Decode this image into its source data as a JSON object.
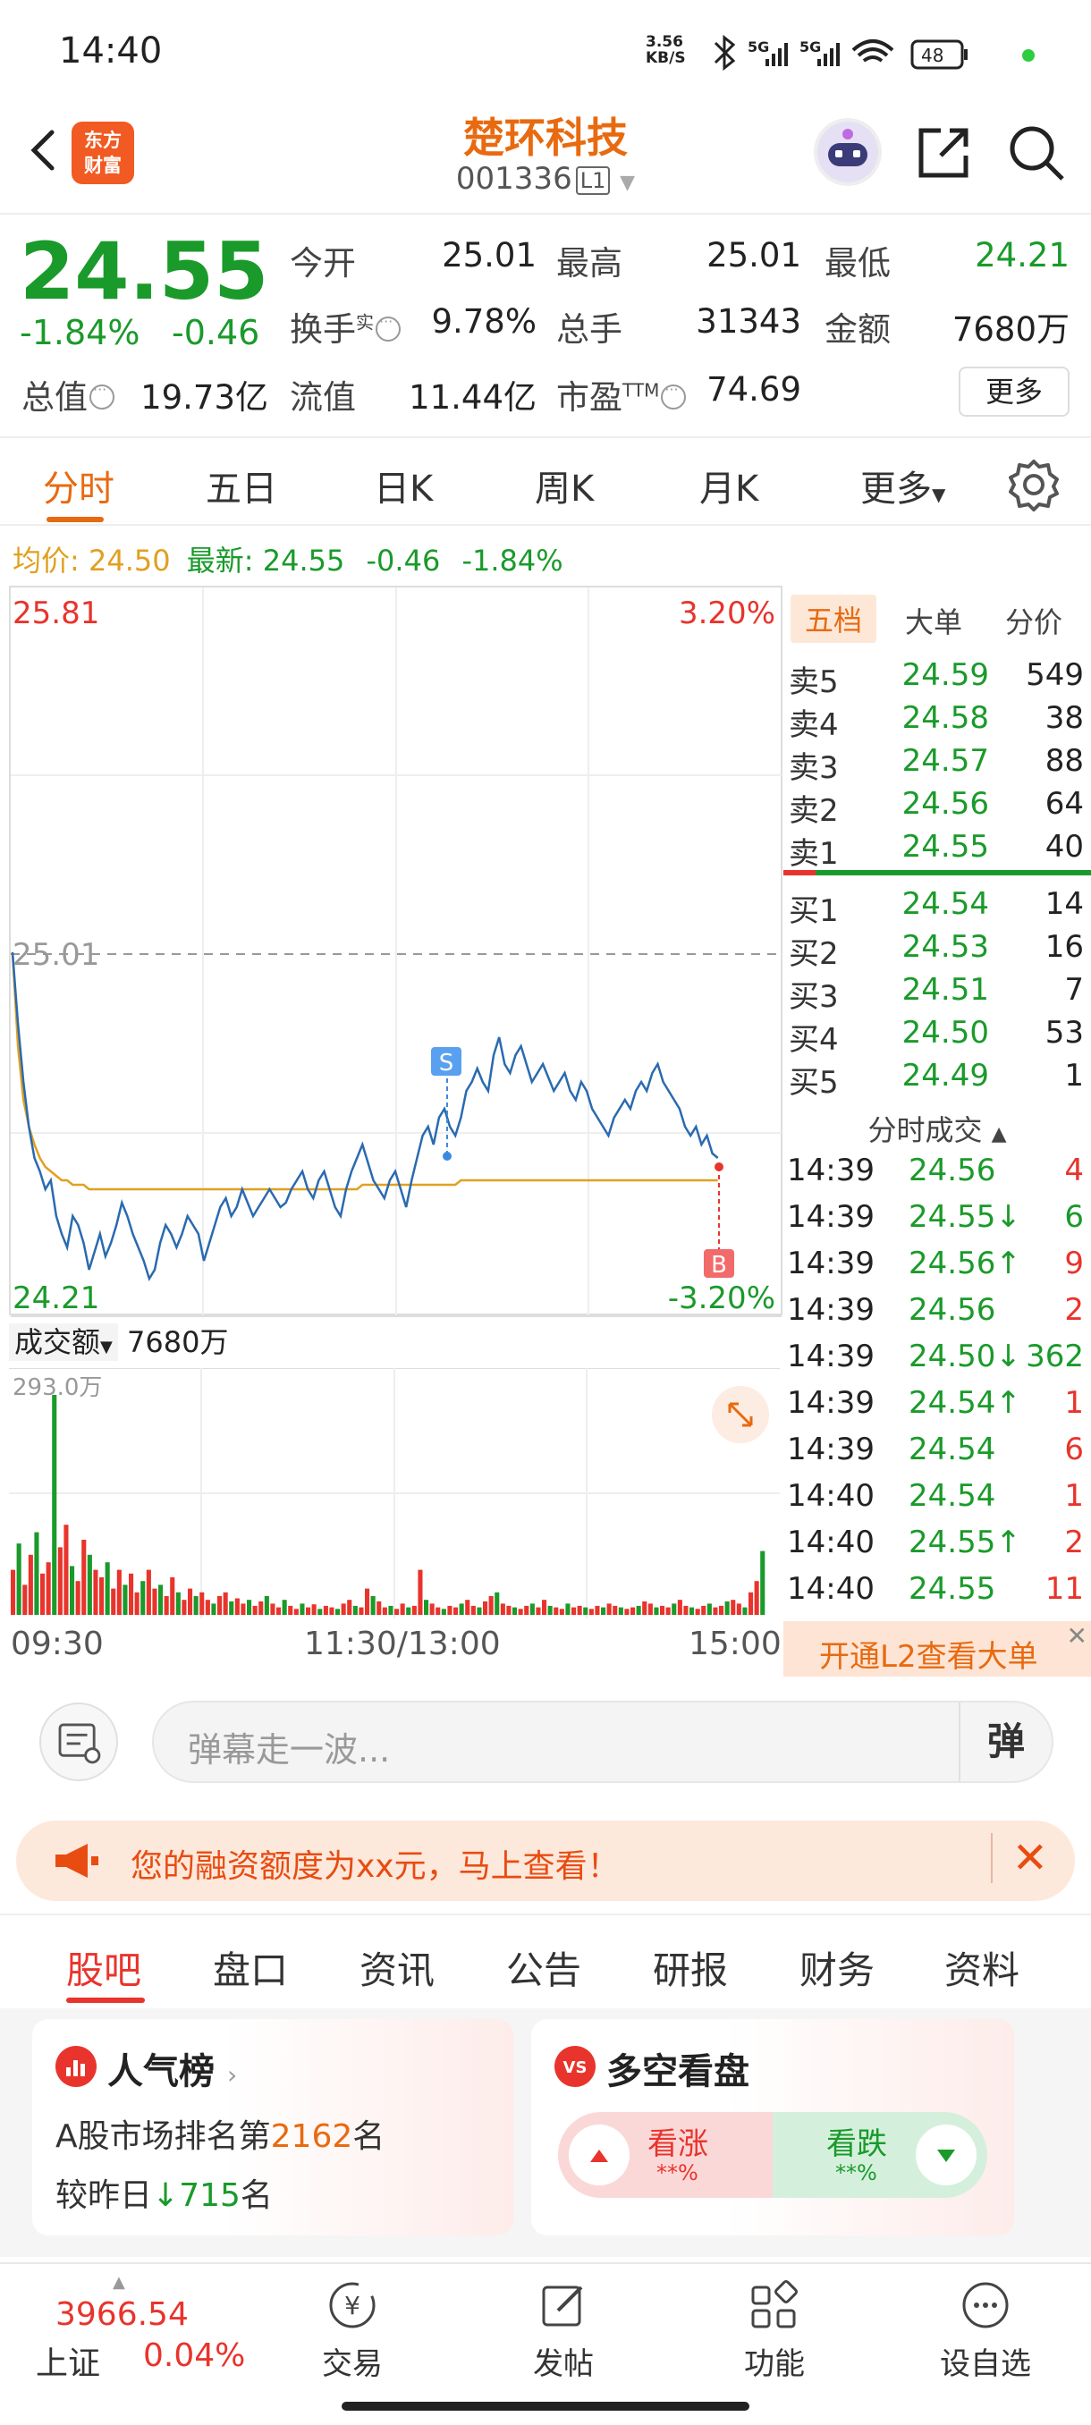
{
  "status": {
    "time": "14:40",
    "net_speed": "3.56",
    "net_unit": "KB/S",
    "battery": "48"
  },
  "header": {
    "brand_line1": "东方",
    "brand_line2": "财富",
    "stock_name": "楚环科技",
    "stock_code": "001336",
    "level": "L1"
  },
  "quote": {
    "price": "24.55",
    "change_pct": "-1.84%",
    "change_amt": "-0.46",
    "open_label": "今开",
    "open": "25.01",
    "high_label": "最高",
    "high": "25.01",
    "low_label": "最低",
    "low": "24.21",
    "turnover_label": "换手",
    "turnover_sup": "实",
    "turnover": "9.78%",
    "volume_label": "总手",
    "volume": "31343",
    "amount_label": "金额",
    "amount": "7680万",
    "mktcap_label": "总值",
    "mktcap": "19.73亿",
    "float_label": "流值",
    "float_cap": "11.44亿",
    "pe_label": "市盈",
    "pe_sup": "TTM",
    "pe": "74.69",
    "more": "更多"
  },
  "chart_tabs": [
    "分时",
    "五日",
    "日K",
    "周K",
    "月K",
    "更多"
  ],
  "avg_bar": {
    "avg_label": "均价:",
    "avg": "24.50",
    "latest_label": "最新:",
    "latest": "24.55",
    "chg": "-0.46",
    "pct": "-1.84%"
  },
  "chart_labels": {
    "y_top": "25.81",
    "y_top_pct": "3.20%",
    "prev_close": "25.01",
    "y_bottom": "24.21",
    "y_bottom_pct": "-3.20%",
    "sell_marker": "S",
    "buy_marker": "B"
  },
  "volume": {
    "label": "成交额",
    "value": "7680万",
    "max_label": "293.0万"
  },
  "time_axis": {
    "start": "09:30",
    "mid": "11:30/13:00",
    "end": "15:00"
  },
  "orderbook": {
    "tabs": [
      "五档",
      "大单",
      "分价"
    ],
    "asks": [
      {
        "label": "卖5",
        "price": "24.59",
        "vol": "549"
      },
      {
        "label": "卖4",
        "price": "24.58",
        "vol": "38"
      },
      {
        "label": "卖3",
        "price": "24.57",
        "vol": "88"
      },
      {
        "label": "卖2",
        "price": "24.56",
        "vol": "64"
      },
      {
        "label": "卖1",
        "price": "24.55",
        "vol": "40"
      }
    ],
    "bids": [
      {
        "label": "买1",
        "price": "24.54",
        "vol": "14"
      },
      {
        "label": "买2",
        "price": "24.53",
        "vol": "16"
      },
      {
        "label": "买3",
        "price": "24.51",
        "vol": "7"
      },
      {
        "label": "买4",
        "price": "24.50",
        "vol": "53"
      },
      {
        "label": "买5",
        "price": "24.49",
        "vol": "1"
      }
    ],
    "ticks_title": "分时成交",
    "ticks": [
      {
        "time": "14:39",
        "price": "24.56",
        "vol": "4",
        "pc": "green",
        "vc": "red"
      },
      {
        "time": "14:39",
        "price": "24.55↓",
        "vol": "6",
        "pc": "green",
        "vc": "green"
      },
      {
        "time": "14:39",
        "price": "24.56↑",
        "vol": "9",
        "pc": "green",
        "vc": "red"
      },
      {
        "time": "14:39",
        "price": "24.56",
        "vol": "2",
        "pc": "green",
        "vc": "red"
      },
      {
        "time": "14:39",
        "price": "24.50↓",
        "vol": "362",
        "pc": "green",
        "vc": "green"
      },
      {
        "time": "14:39",
        "price": "24.54↑",
        "vol": "1",
        "pc": "green",
        "vc": "red"
      },
      {
        "time": "14:39",
        "price": "24.54",
        "vol": "6",
        "pc": "green",
        "vc": "red"
      },
      {
        "time": "14:40",
        "price": "24.54",
        "vol": "1",
        "pc": "green",
        "vc": "red"
      },
      {
        "time": "14:40",
        "price": "24.55↑",
        "vol": "2",
        "pc": "green",
        "vc": "red"
      },
      {
        "time": "14:40",
        "price": "24.55",
        "vol": "11",
        "pc": "green",
        "vc": "red"
      }
    ],
    "l2_text": "开通L2查看大单"
  },
  "danmu": {
    "placeholder": "弹幕走一波...",
    "toggle": "弹"
  },
  "promo": {
    "text": "您的融资额度为xx元，马上查看！"
  },
  "content_tabs": [
    "股吧",
    "盘口",
    "资讯",
    "公告",
    "研报",
    "财务",
    "资料"
  ],
  "cards": {
    "popularity": {
      "title": "人气榜",
      "line1_prefix": "A股市场排名第",
      "rank": "2162",
      "line1_suffix": "名",
      "line2_prefix": "较昨日",
      "delta": "715",
      "line2_suffix": "名"
    },
    "longshort": {
      "title": "多空看盘",
      "up_label": "看涨",
      "up_pct": "**%",
      "down_label": "看跌",
      "down_pct": "**%"
    }
  },
  "bottom_nav": {
    "index_value": "3966.54",
    "index_name": "上证",
    "index_change": "0.04%",
    "items": [
      "交易",
      "发帖",
      "功能",
      "设自选"
    ]
  },
  "colors": {
    "accent": "#e86a10",
    "up": "#e8342c",
    "down": "#1a9a2a",
    "avg_line": "#e0a020",
    "price_line": "#2a6ab0"
  },
  "chart_data": {
    "type": "line",
    "y_range": [
      24.21,
      25.81
    ],
    "prev_close": 25.01,
    "series": [
      {
        "values": [
          25.01,
          24.85,
          24.72,
          24.62,
          24.55,
          24.52,
          24.48,
          24.5,
          24.42,
          24.38,
          24.35,
          24.42,
          24.4,
          24.36,
          24.3,
          24.34,
          24.38,
          24.33,
          24.36,
          24.4,
          24.45,
          24.42,
          24.38,
          24.35,
          24.32,
          24.28,
          24.3,
          24.36,
          24.4,
          24.38,
          24.35,
          24.38,
          24.42,
          24.4,
          24.38,
          24.32,
          24.36,
          24.4,
          24.44,
          24.46,
          24.42,
          24.44,
          24.48,
          24.45,
          24.42,
          24.44,
          24.46,
          24.48,
          24.46,
          24.44,
          24.45,
          24.48,
          24.5,
          24.52,
          24.48,
          24.46,
          24.5,
          24.52,
          24.48,
          24.44,
          24.42,
          24.48,
          24.52,
          24.55,
          24.58,
          24.54,
          24.5,
          24.48,
          24.46,
          24.5,
          24.52,
          24.48,
          24.44,
          24.5,
          24.55,
          24.6,
          24.62,
          24.58,
          24.64,
          24.66,
          24.62,
          24.6,
          24.64,
          24.7,
          24.72,
          24.75,
          24.72,
          24.7,
          24.78,
          24.82,
          24.76,
          24.74,
          24.78,
          24.8,
          24.76,
          24.72,
          24.74,
          24.76,
          24.73,
          24.7,
          24.72,
          24.74,
          24.7,
          24.68,
          24.72,
          24.7,
          24.66,
          24.64,
          24.62,
          24.6,
          24.64,
          24.66,
          24.68,
          24.66,
          24.7,
          24.72,
          24.7,
          24.74,
          24.76,
          24.72,
          24.7,
          24.68,
          24.66,
          24.62,
          24.6,
          24.62,
          24.58,
          24.6,
          24.56,
          24.55
        ]
      },
      {
        "values": [
          25.01,
          24.8,
          24.68,
          24.62,
          24.58,
          24.55,
          24.53,
          24.52,
          24.51,
          24.5,
          24.5,
          24.49,
          24.49,
          24.49,
          24.48,
          24.48,
          24.48,
          24.48,
          24.48,
          24.48,
          24.48,
          24.48,
          24.48,
          24.48,
          24.48,
          24.48,
          24.48,
          24.48,
          24.48,
          24.48,
          24.48,
          24.48,
          24.48,
          24.48,
          24.48,
          24.48,
          24.48,
          24.48,
          24.48,
          24.48,
          24.48,
          24.48,
          24.48,
          24.48,
          24.48,
          24.48,
          24.48,
          24.48,
          24.48,
          24.48,
          24.48,
          24.48,
          24.48,
          24.48,
          24.48,
          24.48,
          24.48,
          24.48,
          24.48,
          24.48,
          24.48,
          24.48,
          24.48,
          24.48,
          24.49,
          24.49,
          24.49,
          24.49,
          24.49,
          24.49,
          24.49,
          24.49,
          24.49,
          24.49,
          24.49,
          24.49,
          24.49,
          24.49,
          24.49,
          24.49,
          24.49,
          24.49,
          24.5,
          24.5,
          24.5,
          24.5,
          24.5,
          24.5,
          24.5,
          24.5,
          24.5,
          24.5,
          24.5,
          24.5,
          24.5,
          24.5,
          24.5,
          24.5,
          24.5,
          24.5,
          24.5,
          24.5,
          24.5,
          24.5,
          24.5,
          24.5,
          24.5,
          24.5,
          24.5,
          24.5,
          24.5,
          24.5,
          24.5,
          24.5,
          24.5,
          24.5,
          24.5,
          24.5,
          24.5,
          24.5,
          24.5,
          24.5,
          24.5,
          24.5,
          24.5,
          24.5,
          24.5,
          24.5,
          24.5,
          24.5
        ]
      }
    ],
    "volume_values": [
      60,
      95,
      40,
      80,
      110,
      55,
      70,
      293,
      90,
      120,
      65,
      45,
      100,
      80,
      60,
      50,
      70,
      35,
      60,
      40,
      55,
      30,
      45,
      60,
      35,
      40,
      25,
      50,
      30,
      20,
      35,
      25,
      30,
      20,
      15,
      25,
      30,
      18,
      22,
      15,
      20,
      12,
      18,
      25,
      15,
      10,
      20,
      12,
      8,
      15,
      10,
      14,
      8,
      12,
      10,
      8,
      15,
      20,
      12,
      10,
      35,
      25,
      18,
      10,
      12,
      8,
      15,
      10,
      12,
      60,
      20,
      15,
      10,
      8,
      12,
      10,
      15,
      20,
      12,
      10,
      18,
      25,
      30,
      15,
      12,
      10,
      8,
      12,
      15,
      10,
      20,
      12,
      10,
      8,
      15,
      10,
      12,
      10,
      8,
      12,
      10,
      15,
      12,
      10,
      8,
      10,
      12,
      18,
      15,
      10,
      12,
      10,
      15,
      20,
      12,
      10,
      8,
      12,
      15,
      10,
      12,
      18,
      20,
      15,
      10,
      30,
      45,
      85
    ]
  }
}
